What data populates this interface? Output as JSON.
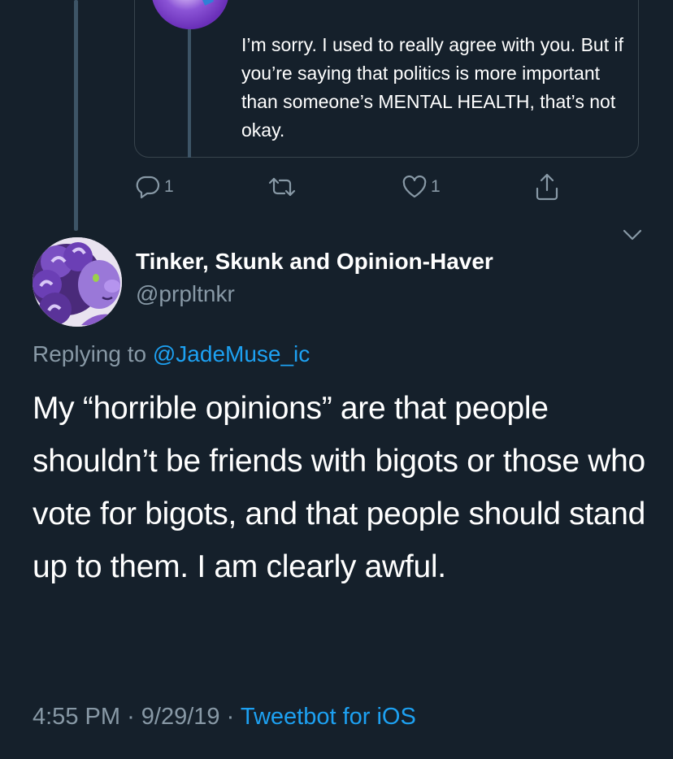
{
  "quoted_tweet": {
    "text": "I’m sorry. I used to really agree with you. But if you’re saying that politics is more important than someone’s MENTAL HEALTH, that’s not okay."
  },
  "actions": {
    "reply_count": "1",
    "retweet_count": "",
    "like_count": "1",
    "icons": [
      "reply-icon",
      "retweet-icon",
      "like-icon",
      "share-icon"
    ]
  },
  "tweet": {
    "author_name": "Tinker, Skunk and Opinion-Haver",
    "author_handle": "@prpltnkr",
    "replying_prefix": "Replying to",
    "replying_to": "@JadeMuse_ic",
    "body": "My “horrible opinions” are that people shouldn’t be friends with bigots or those who vote for bigots, and that people should stand up to them. I am clearly awful.",
    "time": "4:55 PM",
    "date": "9/29/19",
    "separator": "·",
    "source": "Tweetbot for iOS"
  },
  "colors": {
    "background": "#15202b",
    "secondary_text": "#8899a6",
    "link": "#1da1f2",
    "border": "#38444d"
  }
}
